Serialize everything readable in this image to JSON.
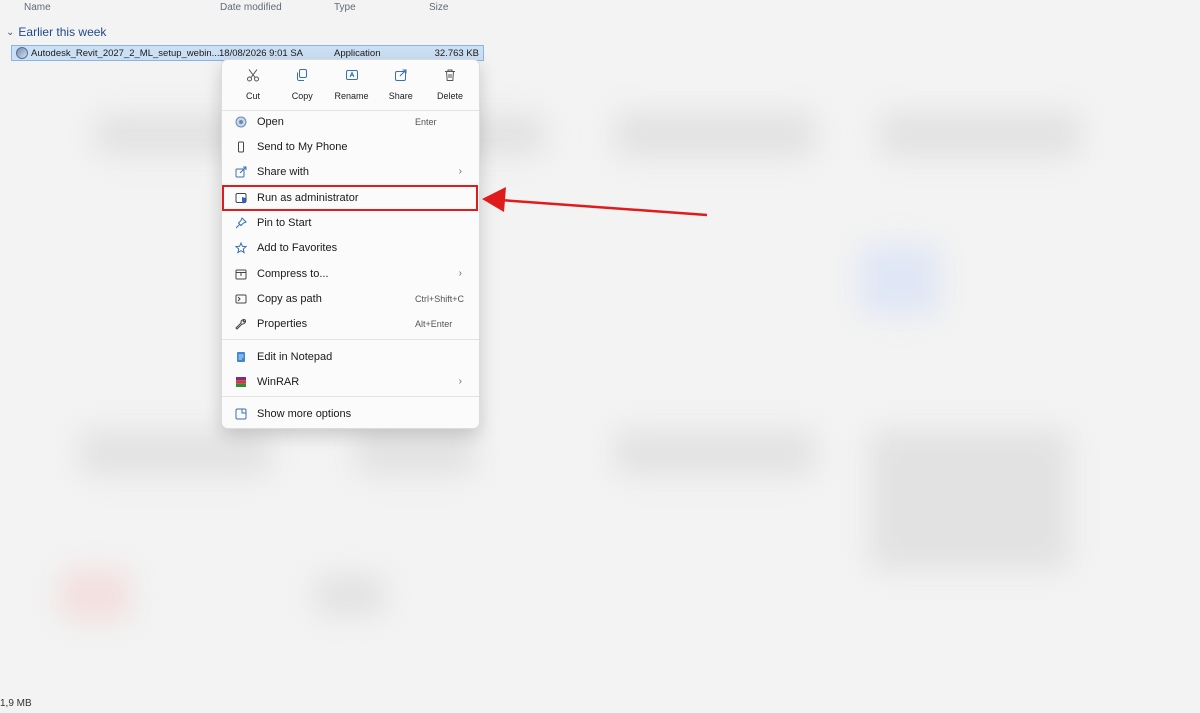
{
  "columns": {
    "name": "Name",
    "date": "Date modified",
    "type": "Type",
    "size": "Size"
  },
  "group": {
    "label": "Earlier this week"
  },
  "file": {
    "name": "Autodesk_Revit_2027_2_ML_setup_webin...",
    "date": "18/08/2026 9:01 SA",
    "type": "Application",
    "size": "32.763 KB"
  },
  "context_menu": {
    "quick_actions": [
      {
        "label": "Cut",
        "icon": "scissors-icon"
      },
      {
        "label": "Copy",
        "icon": "copy-icon"
      },
      {
        "label": "Rename",
        "icon": "rename-icon"
      },
      {
        "label": "Share",
        "icon": "share-icon"
      },
      {
        "label": "Delete",
        "icon": "trash-icon"
      }
    ],
    "items": [
      {
        "label": "Open",
        "shortcut": "Enter",
        "icon": "open-icon"
      },
      {
        "label": "Send to My Phone",
        "icon": "phone-icon"
      },
      {
        "label": "Share with",
        "icon": "share-with-icon",
        "submenu": true
      },
      {
        "label": "Run as administrator",
        "icon": "shield-icon",
        "highlighted": true
      },
      {
        "label": "Pin to Start",
        "icon": "pin-icon"
      },
      {
        "label": "Add to Favorites",
        "icon": "star-icon"
      },
      {
        "label": "Compress to...",
        "icon": "archive-icon",
        "submenu": true
      },
      {
        "label": "Copy as path",
        "shortcut": "Ctrl+Shift+C",
        "icon": "path-icon"
      },
      {
        "label": "Properties",
        "shortcut": "Alt+Enter",
        "icon": "wrench-icon"
      },
      {
        "label": "Edit in Notepad",
        "icon": "notepad-icon"
      },
      {
        "label": "WinRAR",
        "icon": "winrar-icon",
        "submenu": true
      },
      {
        "label": "Show more options",
        "icon": "more-options-icon"
      }
    ]
  },
  "annotation": {
    "color": "#e01b1b"
  },
  "status_bar": {
    "text": "1,9 MB"
  }
}
